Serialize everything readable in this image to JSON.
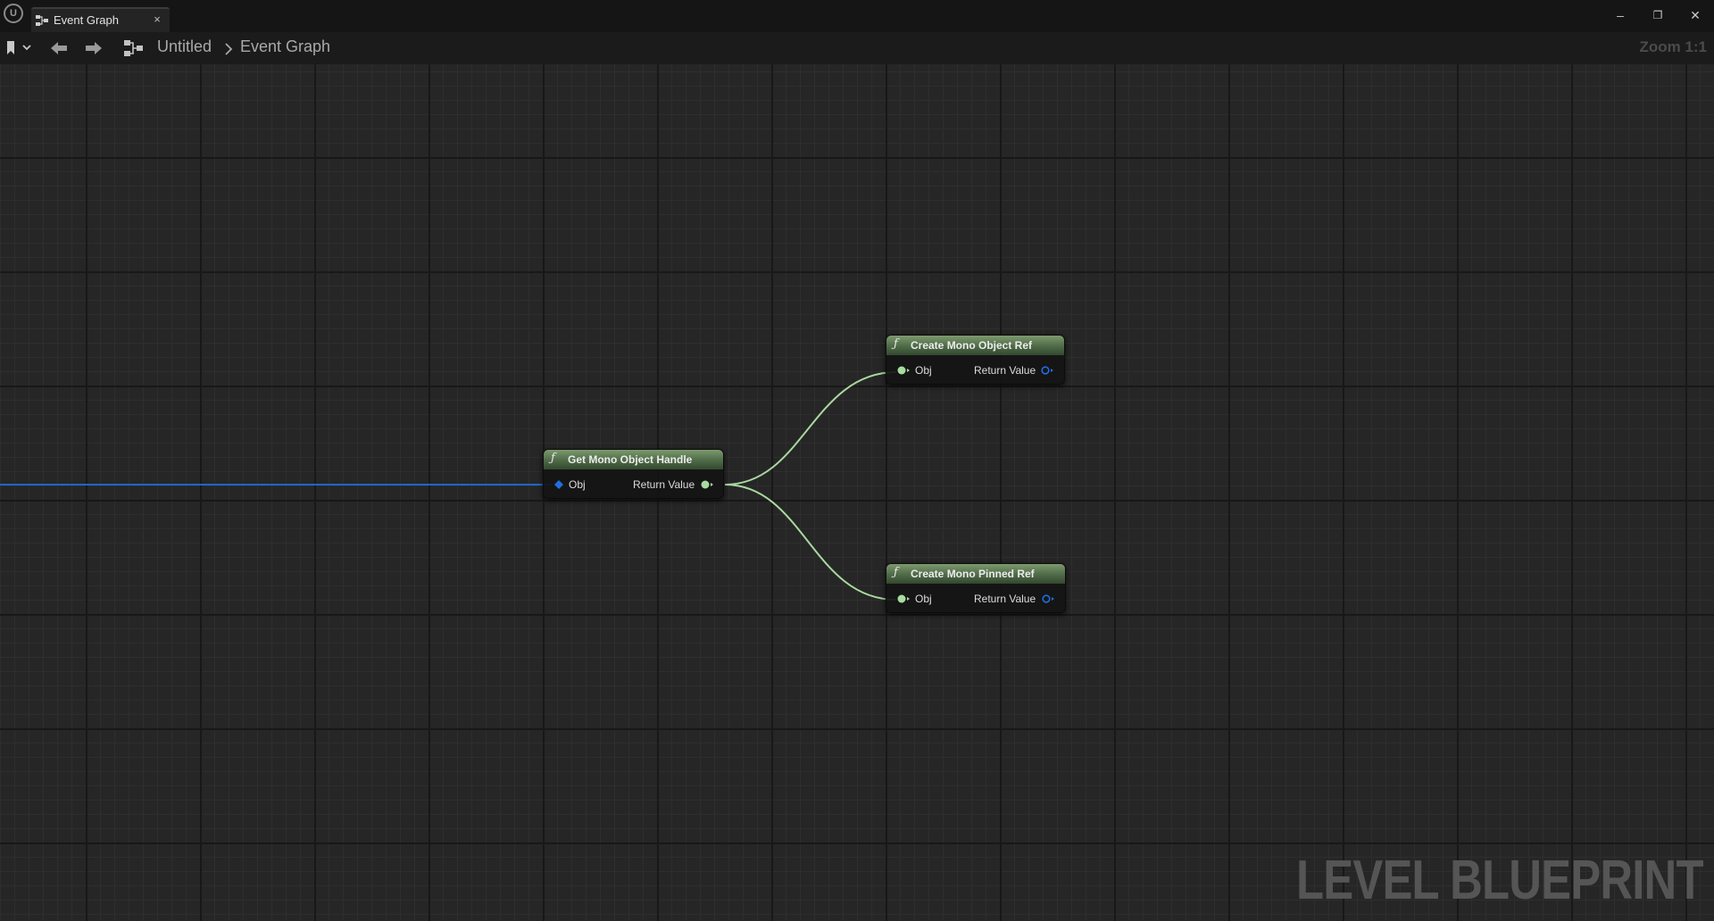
{
  "window": {
    "tab_label": "Event Graph",
    "tab_close": "×",
    "minimize": "–",
    "restore": "❐",
    "close": "✕"
  },
  "toolbar": {
    "breadcrumb_root": "Untitled",
    "breadcrumb_current": "Event Graph",
    "zoom": "Zoom 1:1"
  },
  "graph": {
    "watermark": "LEVEL BLUEPRINT",
    "nodes": {
      "get_handle": {
        "title": "Get Mono Object Handle",
        "input_label": "Obj",
        "output_label": "Return Value"
      },
      "create_ref": {
        "title": "Create Mono Object Ref",
        "input_label": "Obj",
        "output_label": "Return Value"
      },
      "create_pinned": {
        "title": "Create Mono Pinned Ref",
        "input_label": "Obj",
        "output_label": "Return Value"
      }
    }
  },
  "colors": {
    "header_green": "#5a7a50",
    "object_pin_blue": "#1f6fe0",
    "struct_pin_green": "#a9dca0",
    "wire_blue": "#1f66c9",
    "wire_green": "#a9d8a0"
  },
  "icons": {
    "function": "function-icon",
    "graph": "event-graph-icon"
  }
}
